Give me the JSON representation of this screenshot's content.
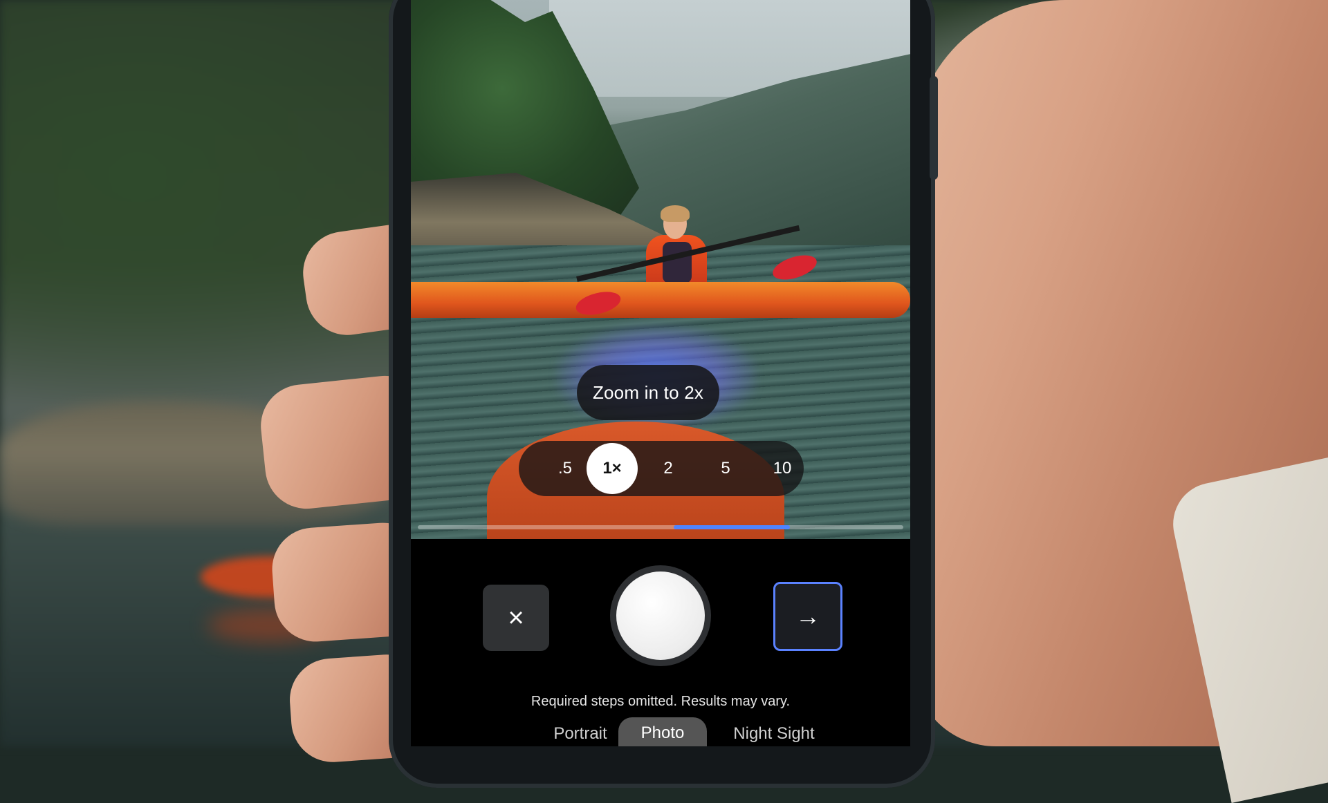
{
  "viewfinder": {
    "suggestion_text": "Zoom in to 2x",
    "zoom_options": [
      ".5",
      "1×",
      "2",
      "5",
      "10"
    ],
    "selected_zoom": "1×",
    "progress_fraction": 0.24
  },
  "controls": {
    "close_icon": "×",
    "next_icon": "→"
  },
  "disclaimer": "Required steps omitted. Results may vary.",
  "modes": [
    "Portrait",
    "Photo",
    "Night Sight"
  ],
  "selected_mode": "Photo",
  "colors": {
    "accent": "#5b82ff",
    "progress": "#4f84ff",
    "kayak": "#e0561d"
  }
}
